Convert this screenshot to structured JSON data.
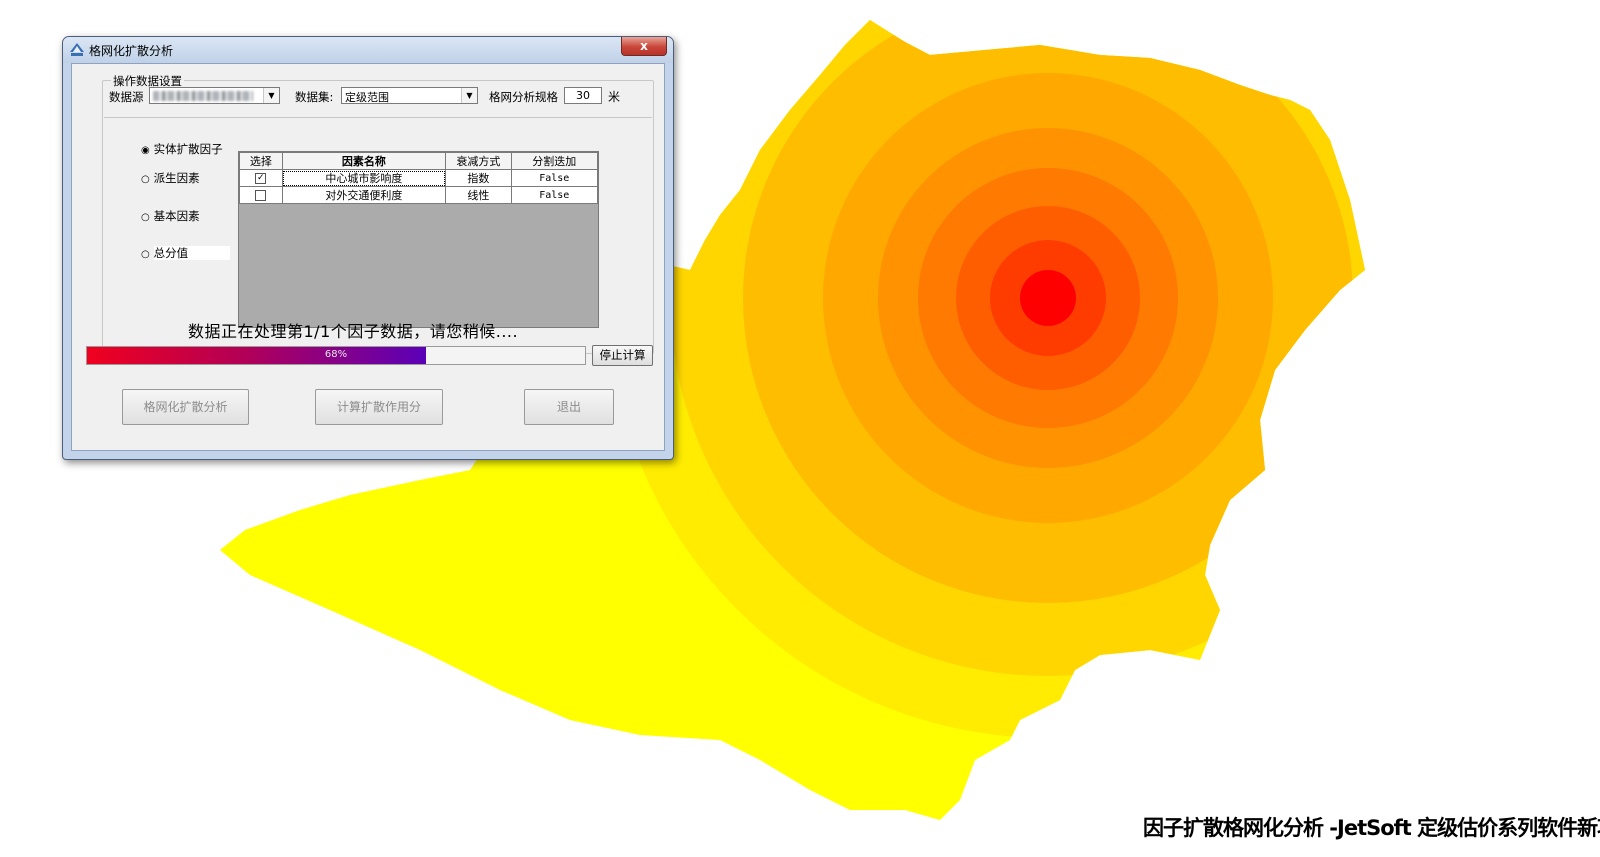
{
  "dialog": {
    "title": "格网化扩散分析",
    "close_label": "x",
    "group_title": "操作数据设置",
    "datasource_label": "数据源",
    "dataset_label": "数据集:",
    "dataset_value": "定级范围",
    "grid_spec_label": "格网分析规格",
    "grid_spec_value": "30",
    "grid_spec_unit": "米",
    "radio_options": [
      {
        "label": "实体扩散因子",
        "selected": true
      },
      {
        "label": "派生因素",
        "selected": false
      },
      {
        "label": "基本因素",
        "selected": false
      },
      {
        "label": "总分值",
        "selected": false
      }
    ],
    "table": {
      "headers": [
        "选择",
        "因素名称",
        "衰减方式",
        "分割迭加"
      ],
      "rows": [
        {
          "checked": true,
          "name": "中心城市影响度",
          "decay": "指数",
          "split": "False"
        },
        {
          "checked": false,
          "name": "对外交通便利度",
          "decay": "线性",
          "split": "False"
        }
      ]
    },
    "status_text": "数据正在处理第1/1个因子数据，请您稍候....",
    "progress": {
      "percent": 68,
      "label": "68%"
    },
    "stop_button": "停止计算",
    "buttons": {
      "grid_analysis": "格网化扩散分析",
      "compute_score": "计算扩散作用分",
      "exit": "退出"
    }
  },
  "caption": "因子扩散格网化分析 -JetSoft 定级估价系列软件新功能",
  "map_colors": {
    "outer": "#ffff00",
    "rings": [
      "#ffec00",
      "#ffd600",
      "#ffbd00",
      "#ffa800",
      "#ff9200",
      "#ff7a00",
      "#ff5e00",
      "#ff3c00",
      "#ff0000"
    ]
  }
}
